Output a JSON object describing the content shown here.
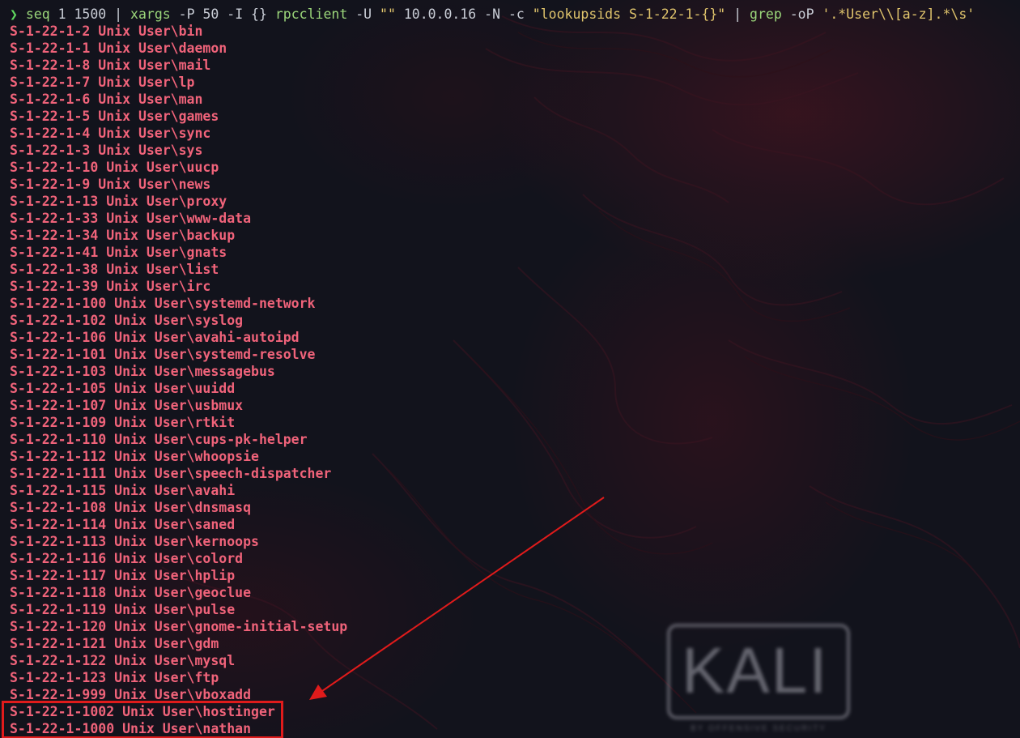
{
  "command": {
    "prompt": "❯",
    "seq": "seq",
    "seq_args": " 1 1500 ",
    "pipe1": "|",
    "xargs": " xargs",
    "xargs_args": " -P 50 -I {} ",
    "rpcclient": "rpcclient",
    "rpc_args": " -U ",
    "empty_str": "\"\"",
    "rpc_args2": " 10.0.0.16 -N -c ",
    "lookup_str": "\"lookupsids S-1-22-1-{}\"",
    "pipe2": " | ",
    "grep": "grep",
    "grep_args": " -oP ",
    "regex": "'.*User\\\\[a-z].*\\s'"
  },
  "output_lines": [
    "S-1-22-1-2 Unix User\\bin",
    "S-1-22-1-1 Unix User\\daemon",
    "S-1-22-1-8 Unix User\\mail",
    "S-1-22-1-7 Unix User\\lp",
    "S-1-22-1-6 Unix User\\man",
    "S-1-22-1-5 Unix User\\games",
    "S-1-22-1-4 Unix User\\sync",
    "S-1-22-1-3 Unix User\\sys",
    "S-1-22-1-10 Unix User\\uucp",
    "S-1-22-1-9 Unix User\\news",
    "S-1-22-1-13 Unix User\\proxy",
    "S-1-22-1-33 Unix User\\www-data",
    "S-1-22-1-34 Unix User\\backup",
    "S-1-22-1-41 Unix User\\gnats",
    "S-1-22-1-38 Unix User\\list",
    "S-1-22-1-39 Unix User\\irc",
    "S-1-22-1-100 Unix User\\systemd-network",
    "S-1-22-1-102 Unix User\\syslog",
    "S-1-22-1-106 Unix User\\avahi-autoipd",
    "S-1-22-1-101 Unix User\\systemd-resolve",
    "S-1-22-1-103 Unix User\\messagebus",
    "S-1-22-1-105 Unix User\\uuidd",
    "S-1-22-1-107 Unix User\\usbmux",
    "S-1-22-1-109 Unix User\\rtkit",
    "S-1-22-1-110 Unix User\\cups-pk-helper",
    "S-1-22-1-112 Unix User\\whoopsie",
    "S-1-22-1-111 Unix User\\speech-dispatcher",
    "S-1-22-1-115 Unix User\\avahi",
    "S-1-22-1-108 Unix User\\dnsmasq",
    "S-1-22-1-114 Unix User\\saned",
    "S-1-22-1-113 Unix User\\kernoops",
    "S-1-22-1-116 Unix User\\colord",
    "S-1-22-1-117 Unix User\\hplip",
    "S-1-22-1-118 Unix User\\geoclue",
    "S-1-22-1-119 Unix User\\pulse",
    "S-1-22-1-120 Unix User\\gnome-initial-setup",
    "S-1-22-1-121 Unix User\\gdm",
    "S-1-22-1-122 Unix User\\mysql",
    "S-1-22-1-123 Unix User\\ftp",
    "S-1-22-1-999 Unix User\\vboxadd",
    "S-1-22-1-1002 Unix User\\hostinger",
    "S-1-22-1-1000 Unix User\\nathan"
  ],
  "watermark": {
    "logo": "KALI",
    "tagline": "BY OFFENSIVE SECURITY"
  },
  "colors": {
    "output": "#f0637a",
    "prompt": "#5fd75f",
    "string": "#e0c46c",
    "annotation": "#e01b1b"
  }
}
